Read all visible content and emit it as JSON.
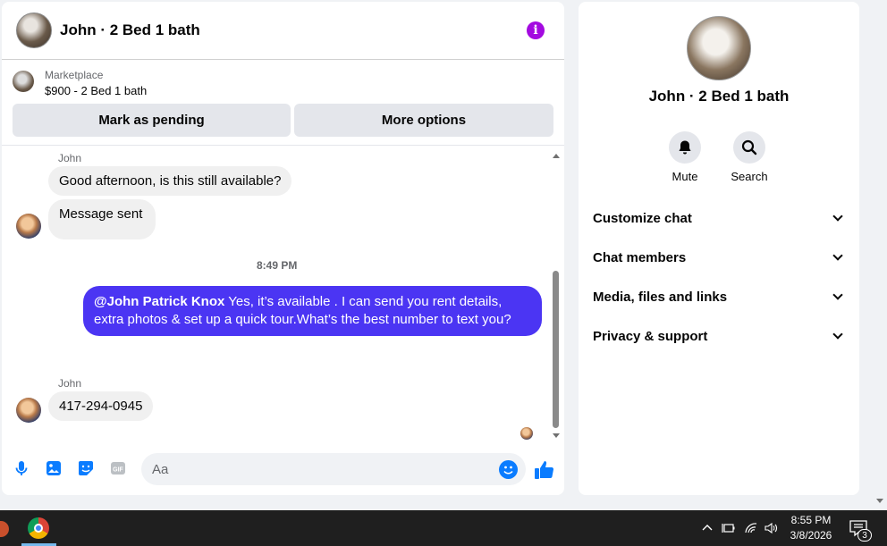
{
  "chat": {
    "title": "John · 2 Bed 1 bath",
    "info_icon": "info-icon",
    "listing": {
      "source": "Marketplace",
      "price_title": "$900 - 2 Bed 1 bath",
      "mark_pending_label": "Mark as pending",
      "more_options_label": "More options"
    },
    "messages": [
      {
        "sender": "John",
        "text": "Good afternoon, is this still available?"
      },
      {
        "sender": "",
        "text": "Message sent"
      },
      {
        "timestamp": "8:49 PM"
      },
      {
        "mention": "@John Patrick Knox",
        "text": " Yes, it’s available .  I can send you rent details, extra photos & set up a quick tour.What’s the best number to text you?"
      },
      {
        "sender": "John",
        "text": "417-294-0945"
      }
    ],
    "composer": {
      "placeholder": "Aa",
      "icons": [
        "microphone-icon",
        "photo-icon",
        "sticker-icon",
        "gif-icon",
        "emoji-icon",
        "like-icon"
      ]
    }
  },
  "side": {
    "title": "John · 2 Bed 1 bath",
    "actions": [
      {
        "label": "Mute",
        "icon": "bell-icon"
      },
      {
        "label": "Search",
        "icon": "search-icon"
      }
    ],
    "sections": [
      "Customize chat",
      "Chat members",
      "Media, files and links",
      "Privacy & support"
    ]
  },
  "taskbar": {
    "time": "8:55 PM",
    "date": "3/8/2026",
    "notification_count": "3"
  },
  "colors": {
    "accent": "#0a7cff",
    "outgoing_bubble": "#4b35f3",
    "info": "#a30ae0"
  }
}
